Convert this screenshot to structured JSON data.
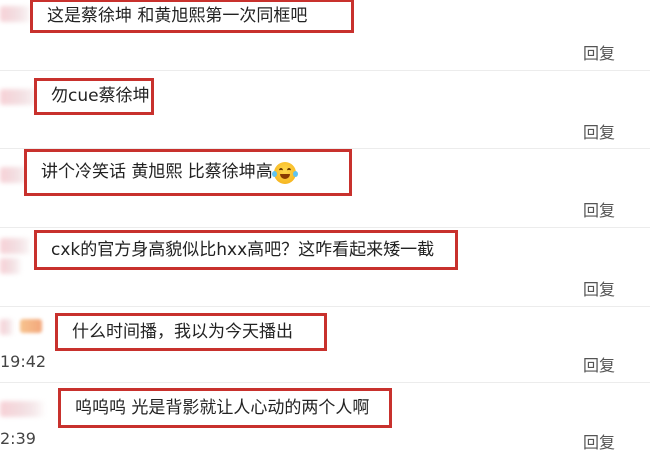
{
  "comments": [
    {
      "text": "这是蔡徐坤 和黄旭熙第一次同框吧",
      "reply": "回复"
    },
    {
      "text": "勿cue蔡徐坤",
      "reply": "回复"
    },
    {
      "text": "讲个冷笑话  黄旭熙 比蔡徐坤高",
      "emoji": "laughing-tears-emoji",
      "reply": "回复"
    },
    {
      "text": "cxk的官方身高貌似比hxx高吧？这咋看起来矮一截",
      "reply": "回复"
    },
    {
      "text": "什么时间播，我以为今天播出",
      "time": "19:42",
      "reply": "回复"
    },
    {
      "text": "呜呜呜 光是背影就让人心动的两个人啊",
      "time": "2:39",
      "reply": "回复"
    }
  ],
  "colors": {
    "highlight_border": "#c8312d",
    "divider": "#ececec"
  }
}
